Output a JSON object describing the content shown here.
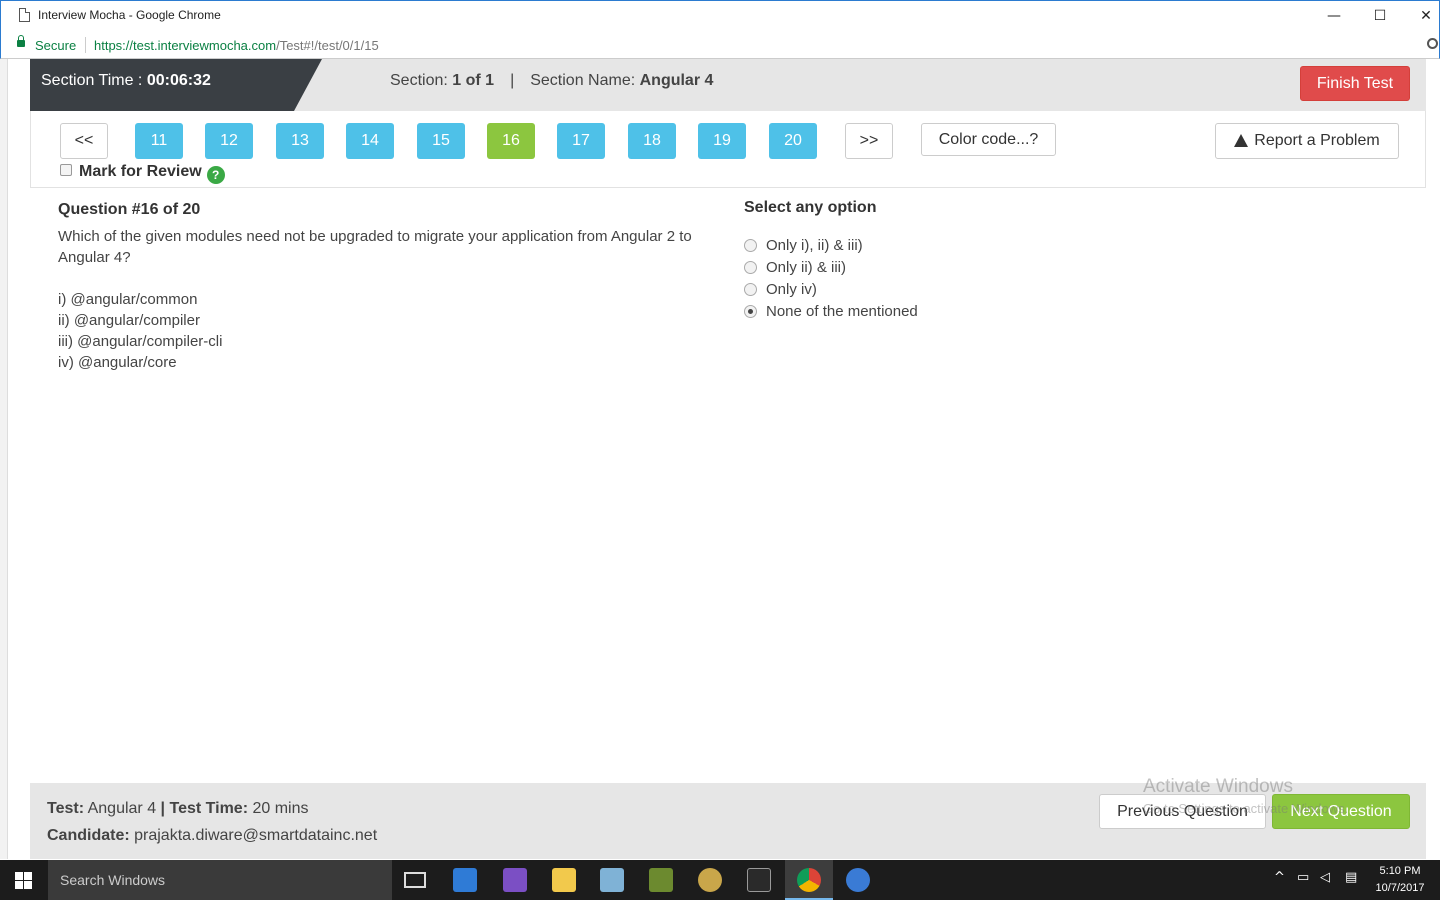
{
  "window": {
    "title": "Interview Mocha - Google Chrome",
    "minimize": "—",
    "maximize": "☐",
    "close": "✕"
  },
  "address_bar": {
    "secure_label": "Secure",
    "url_host": "https://test.interviewmocha.com",
    "url_path": "/Test#!/test/0/1/15"
  },
  "header": {
    "section_time_label": "Section Time : ",
    "section_time_value": "00:06:32",
    "section_label": "Section: ",
    "section_value": "1 of 1",
    "separator": "|",
    "section_name_label": "Section Name: ",
    "section_name_value": "Angular 4",
    "finish_button": "Finish Test"
  },
  "nav": {
    "prev_label": "<<",
    "next_label": ">>",
    "questions": [
      "11",
      "12",
      "13",
      "14",
      "15",
      "16",
      "17",
      "18",
      "19",
      "20"
    ],
    "active_question": "16",
    "color_code_button": "Color code...?",
    "report_button": "Report a Problem",
    "mark_review_label": "Mark for Review",
    "help_glyph": "?"
  },
  "question": {
    "title": "Question #16 of 20",
    "text": "Which of the given modules need not be upgraded to migrate your application from Angular 2 to Angular 4?",
    "items": [
      "i) @angular/common",
      "ii) @angular/compiler",
      "iii) @angular/compiler-cli",
      "iv) @angular/core"
    ]
  },
  "answers": {
    "title": "Select any option",
    "options": [
      "Only i), ii) & iii)",
      "Only ii) & iii)",
      "Only iv)",
      "None of the mentioned"
    ],
    "selected_index": 3
  },
  "footer": {
    "test_label": "Test:",
    "test_value": " Angular 4 ",
    "pipe": "|",
    "test_time_label": " Test Time:",
    "test_time_value": " 20 mins",
    "candidate_label": "Candidate:",
    "candidate_value": " prajakta.diware@smartdatainc.net",
    "prev_button": "Previous Question",
    "next_button": "Next Question"
  },
  "watermark": {
    "line1": "Activate Windows",
    "line2": "Go to Settings to activate Windows."
  },
  "taskbar": {
    "search_placeholder": "Search Windows",
    "time": "5:10 PM",
    "date": "10/7/2017"
  }
}
